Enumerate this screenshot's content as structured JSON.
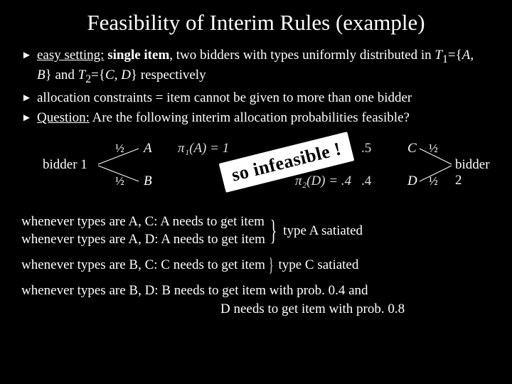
{
  "title": "Feasibility of Interim Rules (example)",
  "bullets": {
    "b1a": "easy setting:",
    "b1b": " single item",
    "b1c": ", two bidders with types uniformly distributed  in ",
    "b1d": "T",
    "b1e": "={",
    "b1f": "A, B",
    "b1g": "} and ",
    "b1h": "T",
    "b1i": "={",
    "b1j": "C, D",
    "b1k": "} respectively",
    "b2": "allocation constraints = item cannot be given to more than one bidder",
    "b3a": "Question:",
    "b3b": " Are the following interim allocation probabilities feasible?"
  },
  "diagram": {
    "bidder1": "bidder 1",
    "bidder2": "bidder 2",
    "half": "½",
    "A": "A",
    "B": "B",
    "C": "C",
    "D": "D",
    "pi1": "π₁(A) = 1",
    "pi2": "π₂(D) = .4",
    "v1": ".5",
    "v2": ".4",
    "infeasible": "so infeasible !"
  },
  "lower": {
    "l1": "whenever types are A, C:  A needs to get item",
    "l2": "whenever types are A, D:  A needs to get item",
    "satA": "type A satiated",
    "l3": "whenever types are B, C:  C needs to get item",
    "satC": "type C satiated",
    "l4a": "whenever types are B, D:  B needs to get item with prob. 0.4 and",
    "l4b": "D needs to get item with prob. 0.8"
  },
  "chart_data": {
    "type": "table",
    "title": "Interim allocation probabilities",
    "bidders": [
      {
        "name": "bidder 1",
        "types": [
          "A",
          "B"
        ],
        "type_prob": [
          0.5,
          0.5
        ]
      },
      {
        "name": "bidder 2",
        "types": [
          "C",
          "D"
        ],
        "type_prob": [
          0.5,
          0.5
        ]
      }
    ],
    "interim_probs": {
      "pi1_A": 1,
      "pi2_D": 0.4
    },
    "shown_values": [
      0.5,
      0.4
    ],
    "feasible": false
  }
}
